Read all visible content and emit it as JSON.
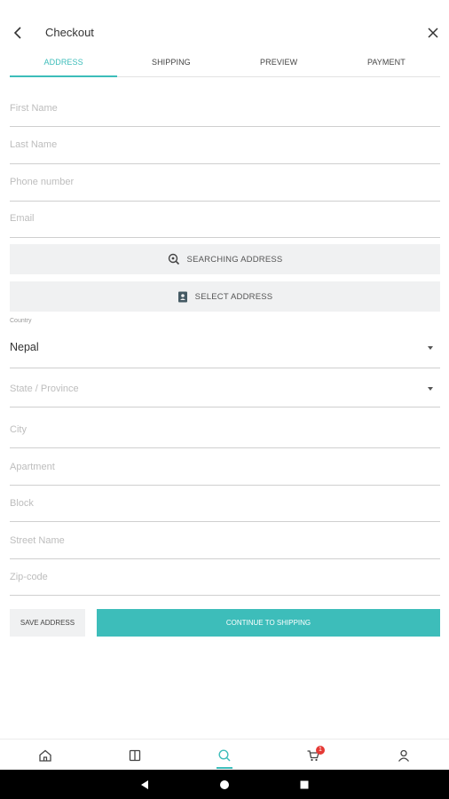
{
  "header": {
    "title": "Checkout"
  },
  "tabs": [
    {
      "label": "ADDRESS"
    },
    {
      "label": "SHIPPING"
    },
    {
      "label": "PREVIEW"
    },
    {
      "label": "PAYMENT"
    }
  ],
  "form": {
    "first_name": "First Name",
    "last_name": "Last Name",
    "phone": "Phone number",
    "email": "Email",
    "search_address": "SEARCHING ADDRESS",
    "select_address": "SELECT ADDRESS",
    "country_label": "Country",
    "country_value": "Nepal",
    "state": "State / Province",
    "city": "City",
    "apartment": "Apartment",
    "block": "Block",
    "street": "Street Name",
    "zip": "Zip-code"
  },
  "actions": {
    "save": "SAVE ADDRESS",
    "continue": "CONTINUE TO SHIPPING"
  },
  "bottom_nav": {
    "items": [
      "home-icon",
      "catalog-icon",
      "search-icon",
      "cart-icon",
      "profile-icon"
    ],
    "cart_badge": "1",
    "accent": "#3dbdba"
  }
}
